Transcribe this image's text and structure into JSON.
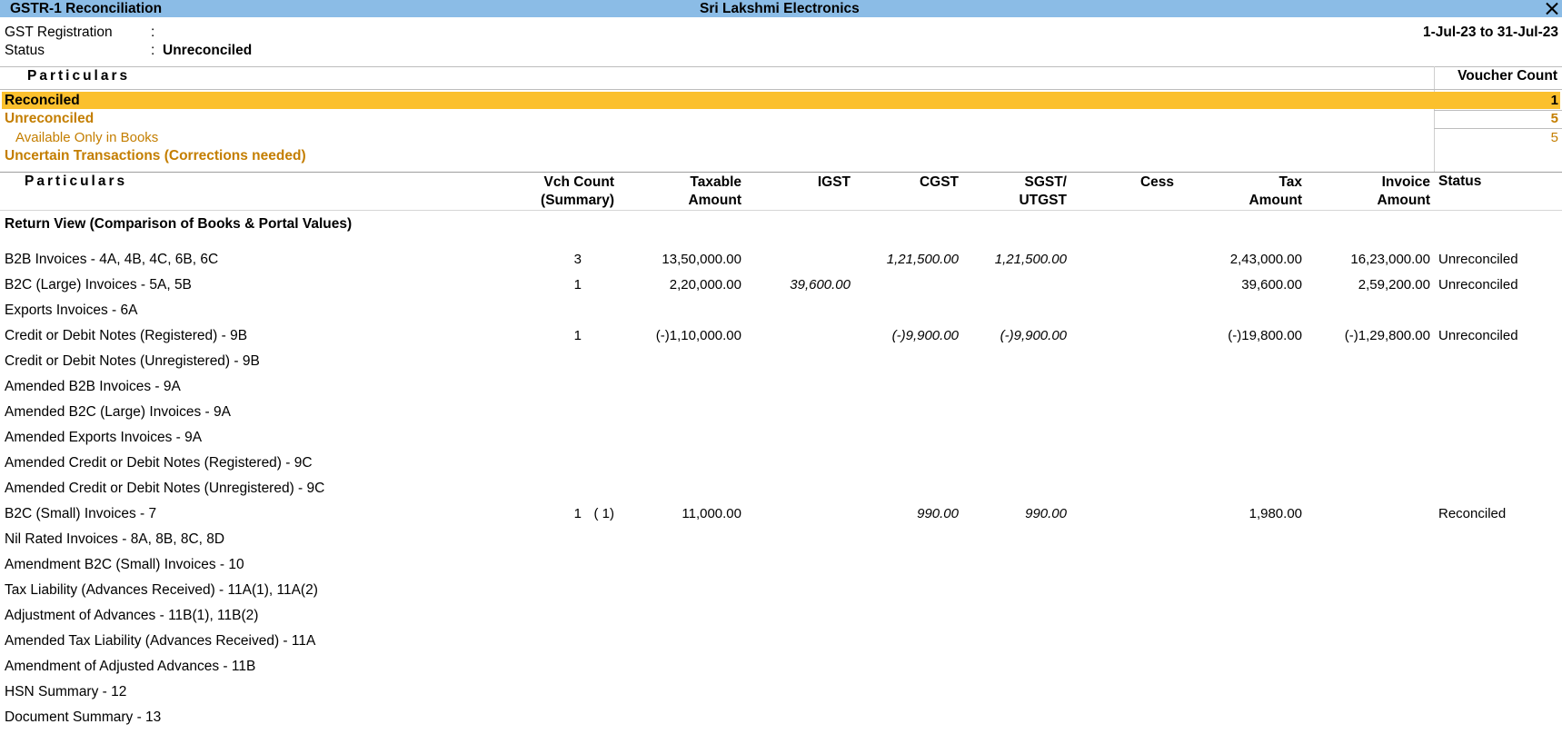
{
  "window": {
    "title": "GSTR-1 Reconciliation",
    "company": "Sri Lakshmi Electronics"
  },
  "info": {
    "gst_label": "GST Registration",
    "status_label": "Status",
    "colon": ":",
    "status_value": "Unreconciled",
    "period": "1-Jul-23 to 31-Jul-23"
  },
  "summary": {
    "col_particulars": "Particulars",
    "col_voucher_count": "Voucher Count",
    "rows": [
      {
        "label": "Reconciled",
        "count": "1"
      },
      {
        "label": "Unreconciled",
        "count": "5"
      },
      {
        "label": "Available Only in Books",
        "count": "5"
      },
      {
        "label": "Uncertain Transactions (Corrections needed)",
        "count": ""
      }
    ]
  },
  "table": {
    "headers": {
      "particulars": "Particulars",
      "vch_count_1": "Vch Count",
      "vch_count_2": "(Summary)",
      "taxable_1": "Taxable",
      "taxable_2": "Amount",
      "igst": "IGST",
      "cgst": "CGST",
      "sgst_1": "SGST/",
      "sgst_2": "UTGST",
      "cess": "Cess",
      "tax_1": "Tax",
      "tax_2": "Amount",
      "invoice_1": "Invoice",
      "invoice_2": "Amount",
      "status": "Status"
    },
    "section_title": "Return View (Comparison of Books & Portal Values)",
    "rows": [
      {
        "label": "B2B Invoices - 4A, 4B, 4C, 6B, 6C",
        "vch": "3",
        "vch_sum": "",
        "taxable": "13,50,000.00",
        "igst": "",
        "cgst": "1,21,500.00",
        "sgst": "1,21,500.00",
        "cess": "",
        "tax": "2,43,000.00",
        "invoice": "16,23,000.00",
        "status": "Unreconciled"
      },
      {
        "label": "B2C (Large) Invoices - 5A, 5B",
        "vch": "1",
        "vch_sum": "",
        "taxable": "2,20,000.00",
        "igst": "39,600.00",
        "cgst": "",
        "sgst": "",
        "cess": "",
        "tax": "39,600.00",
        "invoice": "2,59,200.00",
        "status": "Unreconciled"
      },
      {
        "label": "Exports Invoices - 6A",
        "vch": "",
        "vch_sum": "",
        "taxable": "",
        "igst": "",
        "cgst": "",
        "sgst": "",
        "cess": "",
        "tax": "",
        "invoice": "",
        "status": ""
      },
      {
        "label": "Credit or Debit Notes (Registered) - 9B",
        "vch": "1",
        "vch_sum": "",
        "taxable": "(-)1,10,000.00",
        "igst": "",
        "cgst": "(-)9,900.00",
        "sgst": "(-)9,900.00",
        "cess": "",
        "tax": "(-)19,800.00",
        "invoice": "(-)1,29,800.00",
        "status": "Unreconciled"
      },
      {
        "label": "Credit or Debit Notes (Unregistered) - 9B",
        "vch": "",
        "vch_sum": "",
        "taxable": "",
        "igst": "",
        "cgst": "",
        "sgst": "",
        "cess": "",
        "tax": "",
        "invoice": "",
        "status": ""
      },
      {
        "label": "Amended B2B Invoices - 9A",
        "vch": "",
        "vch_sum": "",
        "taxable": "",
        "igst": "",
        "cgst": "",
        "sgst": "",
        "cess": "",
        "tax": "",
        "invoice": "",
        "status": ""
      },
      {
        "label": "Amended B2C (Large) Invoices - 9A",
        "vch": "",
        "vch_sum": "",
        "taxable": "",
        "igst": "",
        "cgst": "",
        "sgst": "",
        "cess": "",
        "tax": "",
        "invoice": "",
        "status": ""
      },
      {
        "label": "Amended Exports Invoices - 9A",
        "vch": "",
        "vch_sum": "",
        "taxable": "",
        "igst": "",
        "cgst": "",
        "sgst": "",
        "cess": "",
        "tax": "",
        "invoice": "",
        "status": ""
      },
      {
        "label": "Amended Credit or Debit Notes (Registered) - 9C",
        "vch": "",
        "vch_sum": "",
        "taxable": "",
        "igst": "",
        "cgst": "",
        "sgst": "",
        "cess": "",
        "tax": "",
        "invoice": "",
        "status": ""
      },
      {
        "label": "Amended Credit or Debit Notes (Unregistered) - 9C",
        "vch": "",
        "vch_sum": "",
        "taxable": "",
        "igst": "",
        "cgst": "",
        "sgst": "",
        "cess": "",
        "tax": "",
        "invoice": "",
        "status": ""
      },
      {
        "label": "B2C (Small) Invoices - 7",
        "vch": "1",
        "vch_sum": "( 1)",
        "taxable": "11,000.00",
        "igst": "",
        "cgst": "990.00",
        "sgst": "990.00",
        "cess": "",
        "tax": "1,980.00",
        "invoice": "",
        "status": "Reconciled"
      },
      {
        "label": "Nil Rated Invoices - 8A, 8B, 8C, 8D",
        "vch": "",
        "vch_sum": "",
        "taxable": "",
        "igst": "",
        "cgst": "",
        "sgst": "",
        "cess": "",
        "tax": "",
        "invoice": "",
        "status": ""
      },
      {
        "label": "Amendment B2C (Small) Invoices - 10",
        "vch": "",
        "vch_sum": "",
        "taxable": "",
        "igst": "",
        "cgst": "",
        "sgst": "",
        "cess": "",
        "tax": "",
        "invoice": "",
        "status": ""
      },
      {
        "label": "Tax Liability (Advances Received) - 11A(1), 11A(2)",
        "vch": "",
        "vch_sum": "",
        "taxable": "",
        "igst": "",
        "cgst": "",
        "sgst": "",
        "cess": "",
        "tax": "",
        "invoice": "",
        "status": ""
      },
      {
        "label": "Adjustment of Advances - 11B(1), 11B(2)",
        "vch": "",
        "vch_sum": "",
        "taxable": "",
        "igst": "",
        "cgst": "",
        "sgst": "",
        "cess": "",
        "tax": "",
        "invoice": "",
        "status": ""
      },
      {
        "label": "Amended Tax Liability (Advances Received) - 11A",
        "vch": "",
        "vch_sum": "",
        "taxable": "",
        "igst": "",
        "cgst": "",
        "sgst": "",
        "cess": "",
        "tax": "",
        "invoice": "",
        "status": ""
      },
      {
        "label": "Amendment of Adjusted Advances - 11B",
        "vch": "",
        "vch_sum": "",
        "taxable": "",
        "igst": "",
        "cgst": "",
        "sgst": "",
        "cess": "",
        "tax": "",
        "invoice": "",
        "status": ""
      },
      {
        "label": "HSN Summary - 12",
        "vch": "",
        "vch_sum": "",
        "taxable": "",
        "igst": "",
        "cgst": "",
        "sgst": "",
        "cess": "",
        "tax": "",
        "invoice": "",
        "status": ""
      },
      {
        "label": "Document Summary - 13",
        "vch": "",
        "vch_sum": "",
        "taxable": "",
        "igst": "",
        "cgst": "",
        "sgst": "",
        "cess": "",
        "tax": "",
        "invoice": "",
        "status": ""
      }
    ]
  }
}
